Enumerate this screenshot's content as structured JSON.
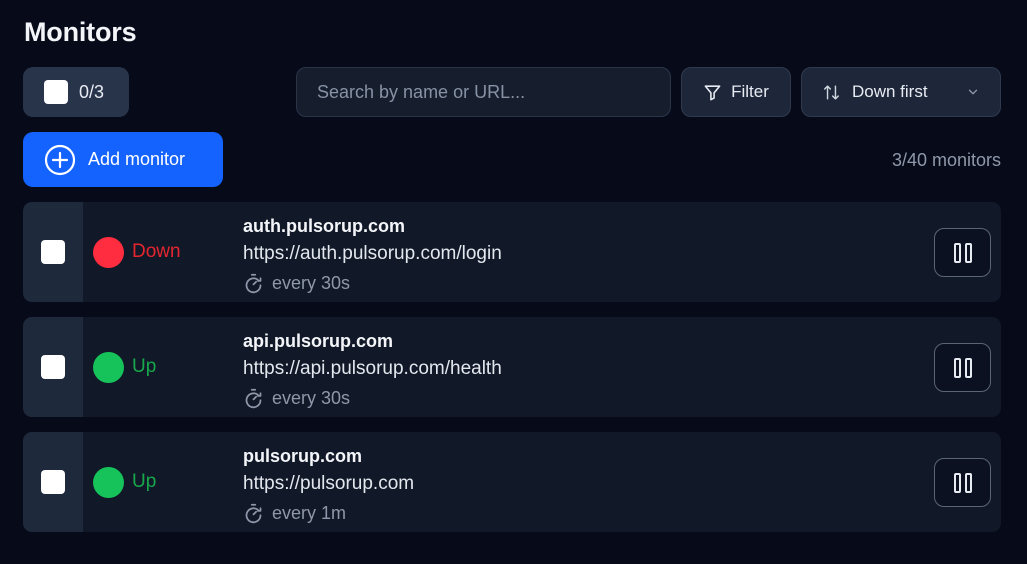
{
  "page": {
    "title": "Monitors"
  },
  "toolbar": {
    "selected_count": "0/3",
    "search_placeholder": "Search by name or URL...",
    "filter_label": "Filter",
    "sort_label": "Down first"
  },
  "actions": {
    "add_monitor_label": "Add monitor",
    "monitors_count": "3/40 monitors"
  },
  "colors": {
    "accent": "#1463ff",
    "status_down": "#ff2d3f",
    "status_up": "#16c35a",
    "down_text": "#e5262f",
    "up_text": "#18a84c"
  },
  "monitors": [
    {
      "status": "Down",
      "name": "auth.pulsorup.com",
      "url": "https://auth.pulsorup.com/login",
      "interval": "every 30s"
    },
    {
      "status": "Up",
      "name": "api.pulsorup.com",
      "url": "https://api.pulsorup.com/health",
      "interval": "every 30s"
    },
    {
      "status": "Up",
      "name": "pulsorup.com",
      "url": "https://pulsorup.com",
      "interval": "every 1m"
    }
  ]
}
